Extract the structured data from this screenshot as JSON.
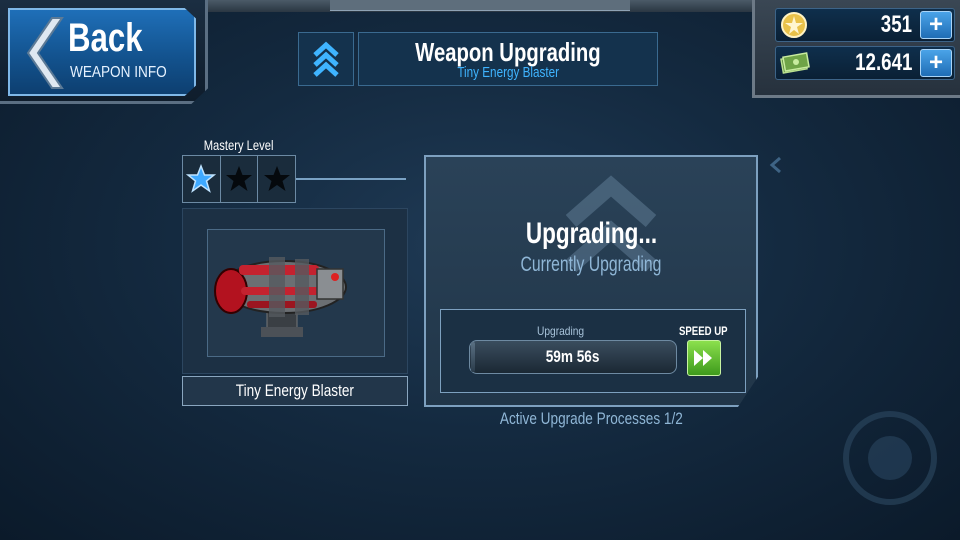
{
  "back": {
    "label": "Back",
    "sublabel": "WEAPON INFO"
  },
  "header": {
    "title": "Weapon Upgrading",
    "subtitle": "Tiny Energy Blaster"
  },
  "currency": {
    "coins": "351",
    "cash": "12.641",
    "plus": "+"
  },
  "mastery": {
    "label": "Mastery Level",
    "stars_filled": 1,
    "stars_total": 3
  },
  "weapon": {
    "name": "Tiny Energy Blaster"
  },
  "upgrade": {
    "title": "Upgrading...",
    "subtitle": "Currently Upgrading",
    "progress_label": "Upgrading",
    "time_remaining": "59m 56s",
    "progress": 0.02,
    "speed_up_label": "SPEED UP"
  },
  "active_processes": "Active Upgrade Processes 1/2",
  "colors": {
    "accent": "#3fb4ff",
    "speedup": "#6cc935",
    "star_active": "#3fa9ff"
  }
}
